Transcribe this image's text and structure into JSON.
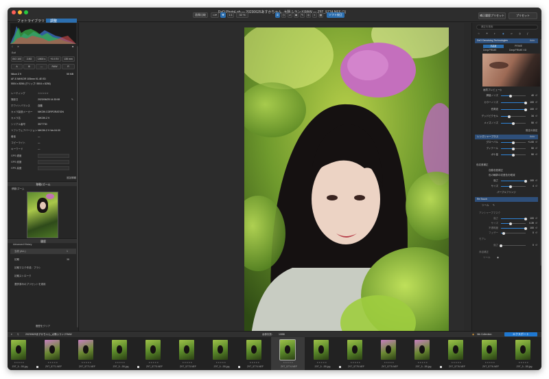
{
  "window": {
    "title": "DxO PhotoLab — 20230625あすかちゃん_太陽ふランドRAW — Z9T_5774.NEF (1)",
    "tabs": [
      "フォトライブラリ",
      "調整"
    ]
  },
  "toolbar": {
    "compare_label": "画像比較",
    "zoom_ratio": "1:1",
    "zoom_level": "32 %",
    "soft_proof_label": "ソフト校正",
    "history_btn": "補正履歴プリセット",
    "preset_btn": "プリセット"
  },
  "left": {
    "exif": {
      "header": "Exif",
      "row1": [
        "ISO 100",
        "2.8G",
        "1/800 s",
        "+0.0 EV",
        "135 mm"
      ],
      "row2": [
        "A",
        "",
        "—",
        "RAW",
        "R"
      ],
      "camera": "Nikon Z 9",
      "camera_size": "55 MB",
      "lens": "AF-S NIKKOR 105mm f/1.4E ED",
      "dimensions": "5504 x 8256 (クリップ: 5504 x 8256)"
    },
    "meta": [
      [
        "レーティング",
        "☆☆☆☆☆"
      ],
      [
        "撮影日",
        "2023/06/25 14:33:08"
      ],
      [
        "ホワイトバランス",
        "自動"
      ],
      [
        "カメラ製造メーカー",
        "NIKON CORPORATION"
      ],
      [
        "カメラ名",
        "NIKON Z 9"
      ],
      [
        "シリアル番号",
        "3577730"
      ],
      [
        "ソフトウェアバージョン",
        "NIKON Z 9 Ver.04.00"
      ],
      [
        "著者",
        "—"
      ],
      [
        "コピーライト",
        "—"
      ],
      [
        "キーワード",
        "—"
      ]
    ],
    "gps": [
      [
        "GPS 緯度",
        ""
      ],
      [
        "GPS 経度",
        ""
      ],
      [
        "GPS 高度",
        ""
      ]
    ],
    "meta_link": "追加情報",
    "loupe_title": "移動/ズーム",
    "loupe_label": "移動/ズーム",
    "history_title": "履歴",
    "history_header": "Advanced History",
    "history_items": [
      [
        "当初 (ALL)",
        "1"
      ],
      [
        "初期",
        "38"
      ],
      [
        "初期マスク作成：ブラシ",
        ""
      ],
      [
        "初期ストローク",
        ""
      ],
      [
        "選択済みのプリセットを適用",
        ""
      ]
    ],
    "history_clear": "履歴をクリア"
  },
  "right": {
    "search_placeholder": "補正を検索",
    "denoise": {
      "title": "DxO Denoising Technologies",
      "mode": "Auto",
      "opt_a": "高品質",
      "opt_b": "PRIME",
      "chk_a": "DeepPRIME",
      "chk_b": "DeepPRIME XD"
    },
    "preview_label": "画質プレビュー",
    "sliders1": [
      {
        "label": "輝度ノイズ",
        "value": "40",
        "level": 0.4
      },
      {
        "label": "カラーノイズ",
        "value": "100",
        "level": 1.0
      },
      {
        "label": "低周波",
        "value": "100",
        "level": 1.0
      },
      {
        "label": "デッドピクセル",
        "value": "34",
        "level": 0.34
      },
      {
        "label": "メイズノイズ",
        "value": "50",
        "level": 0.5
      }
    ],
    "default_link": "既定の設定",
    "lens_title": "レンズシャープネス",
    "lens_mode": "Auto",
    "sliders2": [
      {
        "label": "グローバル",
        "value": "+1.00",
        "level": 0.5
      },
      {
        "label": "ディテール",
        "value": "50",
        "level": 0.5
      },
      {
        "label": "ボケ量",
        "value": "50",
        "level": 0.5
      }
    ],
    "optics": {
      "title": "色収差補正",
      "option_a": "自動収差補正",
      "option_b": "色の輪郭の収差色を軽減"
    },
    "sliders3": [
      {
        "label": "強さ",
        "value": "100",
        "level": 1.0
      },
      {
        "label": "サイズ",
        "value": "4",
        "level": 0.4
      }
    ],
    "purple_link": "パープルフリンジ",
    "retouch_title": "Re:Touch",
    "retouch_tool": "ツール",
    "sliders4": [
      {
        "label": "強さ",
        "value": "100",
        "level": 1.0
      },
      {
        "label": "サイズ",
        "value": "0.39",
        "level": 0.39
      },
      {
        "label": "不透明度",
        "value": "100",
        "level": 1.0
      },
      {
        "label": "フェザー",
        "value": "0",
        "level": 0.1
      }
    ],
    "dim_sect1": "アンシャープマスク",
    "dim_sect2": "モアレ",
    "dim_sect3": "赤目補正",
    "sliders5": [
      {
        "label": "強さ",
        "value": "0",
        "level": 0.0
      }
    ],
    "tool_label": "ツール"
  },
  "bottombar": {
    "path": "20230625あすかちゃん_太陽ふランドRAW",
    "count_label": "画像枚数：",
    "count": "1/558",
    "collection_label": "Nik Collection",
    "export_label": "エクスポート"
  },
  "film": [
    {
      "name": "Z9T_5...3B.jpg",
      "check": false,
      "tone": "g",
      "sel": false
    },
    {
      "name": "Z9T_5771.NEF",
      "check": true,
      "tone": "p",
      "sel": false
    },
    {
      "name": "Z9T_5771.NEF",
      "check": false,
      "tone": "p",
      "sel": false
    },
    {
      "name": "Z9T_5...3B.jpg",
      "check": false,
      "tone": "g",
      "sel": false
    },
    {
      "name": "Z9T_5773.NEF",
      "check": true,
      "tone": "g",
      "sel": false
    },
    {
      "name": "Z9T_5773.NEF",
      "check": false,
      "tone": "g",
      "sel": false
    },
    {
      "name": "Z9T_5...3B.jpg",
      "check": false,
      "tone": "g",
      "sel": false
    },
    {
      "name": "Z9T_5774.NEF",
      "check": true,
      "tone": "g",
      "sel": false
    },
    {
      "name": "Z9T_5774.NEF",
      "check": false,
      "tone": "g",
      "sel": true
    },
    {
      "name": "Z9T_5...3B.jpg",
      "check": false,
      "tone": "g",
      "sel": false
    },
    {
      "name": "Z9T_5775.NEF",
      "check": true,
      "tone": "g",
      "sel": false
    },
    {
      "name": "Z9T_5775.NEF",
      "check": false,
      "tone": "p",
      "sel": false
    },
    {
      "name": "Z9T_5...3B.jpg",
      "check": false,
      "tone": "p",
      "sel": false
    },
    {
      "name": "Z9T_5776.NEF",
      "check": true,
      "tone": "g",
      "sel": false
    },
    {
      "name": "Z9T_5776.NEF",
      "check": false,
      "tone": "g",
      "sel": false
    },
    {
      "name": "Z9T_5...3B.jpg",
      "check": false,
      "tone": "g",
      "sel": false
    }
  ],
  "colors": {
    "accent": "#2c6fb0",
    "panel": "#262626",
    "export": "#1f78d1"
  }
}
